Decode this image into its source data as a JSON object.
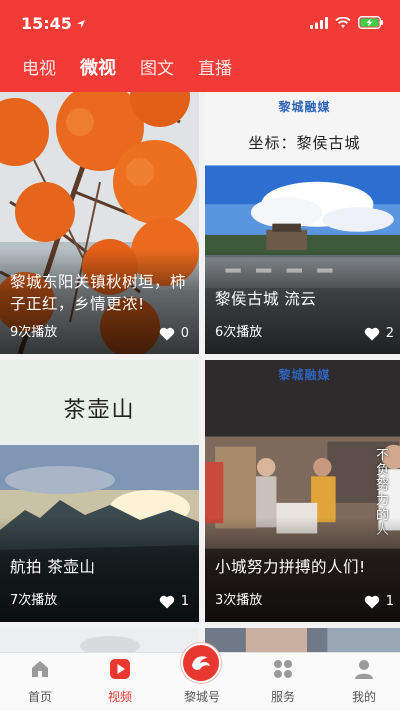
{
  "status_bar": {
    "time": "15:45"
  },
  "tabs": [
    {
      "label": "电视",
      "active": false
    },
    {
      "label": "微视",
      "active": true
    },
    {
      "label": "图文",
      "active": false
    },
    {
      "label": "直播",
      "active": false
    }
  ],
  "cards": [
    {
      "title": "黎城东阳关镇秋树垣，柿子正红，乡情更浓!",
      "plays": "9次播放",
      "likes": "0"
    },
    {
      "title": "黎侯古城 流云",
      "plays": "6次播放",
      "likes": "2",
      "banner_brand": "黎城融媒",
      "banner_text": "坐标：黎侯古城"
    },
    {
      "title": "航拍 茶壶山",
      "plays": "7次播放",
      "likes": "1",
      "banner_text": "茶壶山"
    },
    {
      "title": "小城努力拼搏的人们!",
      "plays": "3次播放",
      "likes": "1",
      "banner_brand": "黎城融媒",
      "overlay_text": "不负努力的人"
    }
  ],
  "nav": [
    {
      "label": "首页",
      "icon": "home-icon",
      "active": false
    },
    {
      "label": "视频",
      "icon": "video-play-icon",
      "active": true
    },
    {
      "label": "黎城号",
      "icon": "bird-logo-icon",
      "active": false
    },
    {
      "label": "服务",
      "icon": "services-grid-icon",
      "active": false
    },
    {
      "label": "我的",
      "icon": "user-profile-icon",
      "active": false
    }
  ],
  "colors": {
    "brand_red": "#f23b36",
    "nav_active": "#e8382f"
  }
}
